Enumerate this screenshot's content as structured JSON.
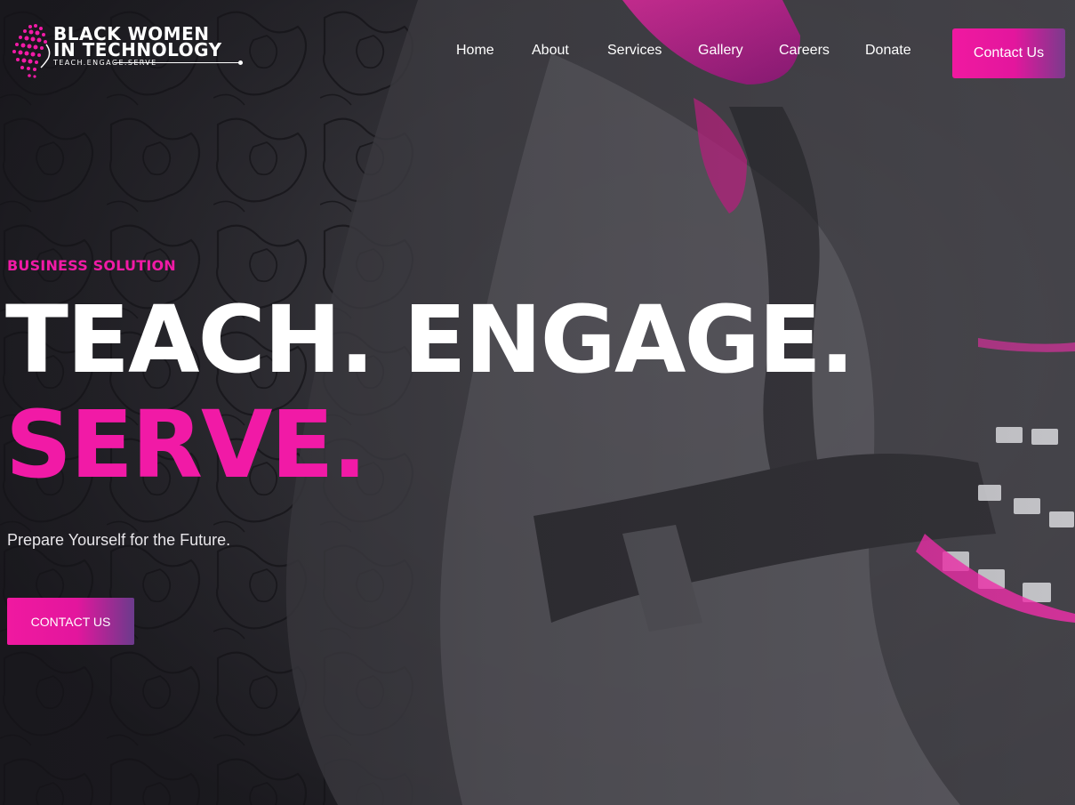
{
  "brand": {
    "name_line1": "BLACK WOMEN",
    "name_line2": "IN TECHNOLOGY",
    "tagline": "TEACH.ENGAGE.SERVE",
    "logo_icon": "pixel-woman-profile-icon",
    "accent_color": "#f11aa6"
  },
  "nav": {
    "items": [
      {
        "label": "Home"
      },
      {
        "label": "About"
      },
      {
        "label": "Services"
      },
      {
        "label": "Gallery"
      },
      {
        "label": "Careers"
      },
      {
        "label": "Donate"
      }
    ],
    "contact_label": "Contact Us"
  },
  "hero": {
    "eyebrow": "BUSINESS SOLUTION",
    "headline_line1": "TEACH. ENGAGE.",
    "headline_line2": "SERVE.",
    "subtext": "Prepare Yourself for the Future.",
    "cta_label": "CONTACT US",
    "headline_color": "#ffffff",
    "highlight_color": "#f11aa6"
  }
}
